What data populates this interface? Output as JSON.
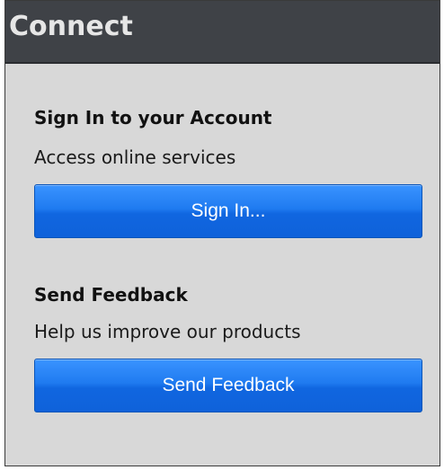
{
  "window": {
    "title": "Connect"
  },
  "account": {
    "heading": "Sign In to your Account",
    "description": "Access online services",
    "button_label": "Sign In..."
  },
  "feedback": {
    "heading": "Send Feedback",
    "description": "Help us improve our products",
    "button_label": "Send Feedback"
  },
  "colors": {
    "titlebar": "#3f4247",
    "panel": "#d8d8d8",
    "button": "#1f7bf0"
  }
}
